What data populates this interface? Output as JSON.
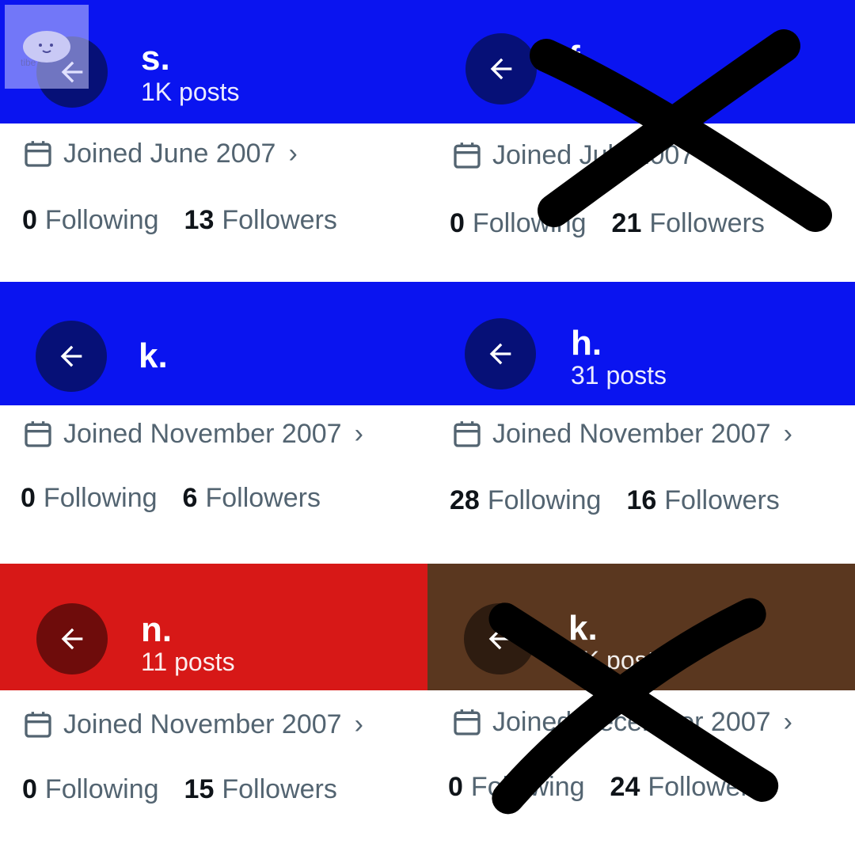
{
  "profiles": [
    {
      "name": "s.",
      "posts": "1K posts",
      "joined": "Joined June 2007",
      "following_count": "0",
      "following_label": "Following",
      "followers_count": "13",
      "followers_label": "Followers",
      "banner_color": "#0a14f0",
      "button_color": "#061077",
      "crossed": false
    },
    {
      "name": "f",
      "posts": "",
      "joined": "Joined July 2007",
      "following_count": "0",
      "following_label": "Following",
      "followers_count": "21",
      "followers_label": "Followers",
      "banner_color": "#0a14f0",
      "button_color": "#061077",
      "crossed": true
    },
    {
      "name": "k.",
      "posts": "",
      "joined": "Joined November 2007",
      "following_count": "0",
      "following_label": "Following",
      "followers_count": "6",
      "followers_label": "Followers",
      "banner_color": "#0a14f0",
      "button_color": "#061077",
      "crossed": false
    },
    {
      "name": "h.",
      "posts": "31 posts",
      "joined": "Joined November 2007",
      "following_count": "28",
      "following_label": "Following",
      "followers_count": "16",
      "followers_label": "Followers",
      "banner_color": "#0a14f0",
      "button_color": "#061077",
      "crossed": false
    },
    {
      "name": "n.",
      "posts": "11 posts",
      "joined": "Joined November 2007",
      "following_count": "0",
      "following_label": "Following",
      "followers_count": "15",
      "followers_label": "Followers",
      "banner_color": "#d71817",
      "button_color": "#6e0c0b",
      "crossed": false
    },
    {
      "name": "k.",
      "posts": "5K posts",
      "joined": "Joined December 2007",
      "following_count": "0",
      "following_label": "Following",
      "followers_count": "24",
      "followers_label": "Followers",
      "banner_color": "#5a371f",
      "button_color": "#2e1c10",
      "crossed": true
    }
  ],
  "watermark": {
    "text": "tibe"
  }
}
